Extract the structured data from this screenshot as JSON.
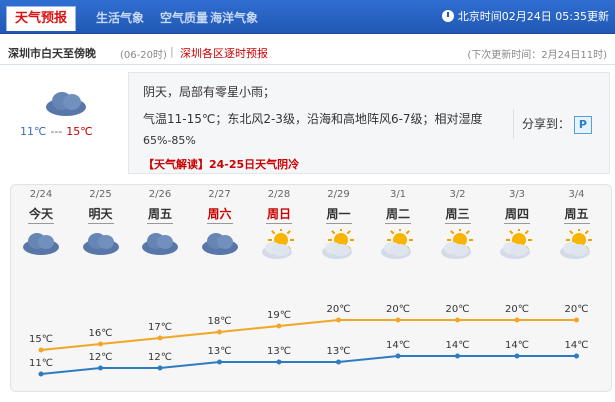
{
  "header": {
    "active_tab": "天气预报",
    "tabs": [
      "生活气象",
      "空气质量",
      "海洋气象"
    ],
    "time_label": "北京时间02月24日 05:35更新"
  },
  "subbar": {
    "city": "深圳市白天至傍晚",
    "range": "(06-20时)",
    "sep": "|",
    "link": "深圳各区逐时预报",
    "update": "(下次更新时间：2月24日11时)"
  },
  "today": {
    "low": "11℃",
    "dash": "---",
    "high": "15℃",
    "line1": "阴天，局部有零星小雨；",
    "line2": "气温11-15℃；东北风2-3级，沿海和高地阵风6-7级；相对湿度",
    "line3": "65%-85%",
    "interp_tag": "【天气解读】",
    "interp_text": "24-25日天气阴冷",
    "share_label": "分享到：",
    "share_icon": "P"
  },
  "colors": {
    "high_line": "#f2a626",
    "low_line": "#2f7bc2",
    "weekend": "#cc0000"
  },
  "chart_data": {
    "type": "line",
    "categories": [
      "2/24",
      "2/25",
      "2/26",
      "2/27",
      "2/28",
      "2/29",
      "3/1",
      "3/2",
      "3/3",
      "3/4"
    ],
    "day_names": [
      "今天",
      "明天",
      "周五",
      "周六",
      "周日",
      "周一",
      "周二",
      "周三",
      "周四",
      "周五"
    ],
    "weekend": [
      false,
      false,
      false,
      true,
      true,
      false,
      false,
      false,
      false,
      false
    ],
    "icons": [
      "cloud-icon",
      "cloud-icon",
      "cloud-icon",
      "cloud-icon",
      "sun-cloud-icon",
      "sun-cloud-icon",
      "sun-cloud-icon",
      "sun-cloud-icon",
      "sun-cloud-icon",
      "sun-cloud-icon"
    ],
    "series": [
      {
        "name": "high",
        "values": [
          15,
          16,
          17,
          18,
          19,
          20,
          20,
          20,
          20,
          20
        ],
        "labels": [
          "15℃",
          "16℃",
          "17℃",
          "18℃",
          "19℃",
          "20℃",
          "20℃",
          "20℃",
          "20℃",
          "20℃"
        ]
      },
      {
        "name": "low",
        "values": [
          11,
          12,
          12,
          13,
          13,
          13,
          14,
          14,
          14,
          14
        ],
        "labels": [
          "11℃",
          "12℃",
          "12℃",
          "13℃",
          "13℃",
          "13℃",
          "14℃",
          "14℃",
          "14℃",
          "14℃"
        ]
      }
    ]
  }
}
